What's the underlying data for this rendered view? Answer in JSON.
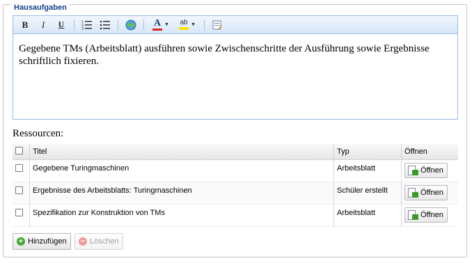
{
  "section": {
    "title": "Hausaufgaben"
  },
  "toolbar": {
    "bold": "B",
    "italic": "I",
    "underline": "U",
    "font_color": "A",
    "highlight": "ab"
  },
  "editor": {
    "content": "Gegebene TMs (Arbeitsblatt) ausführen sowie Zwischenschritte der Ausführung sowie Ergebnisse schriftlich fixieren."
  },
  "resources": {
    "label": "Ressourcen:",
    "columns": {
      "title": "Titel",
      "type": "Typ",
      "open": "Öffnen"
    },
    "rows": [
      {
        "title": "Gegebene Turingmaschinen",
        "type": "Arbeitsblatt",
        "open_label": "Öffnen"
      },
      {
        "title": "Ergebnisse des Arbeitsblatts: Turingmaschinen",
        "type": "Schüler erstellt",
        "open_label": "Öffnen"
      },
      {
        "title": "Spezifikation zur Konstruktion von TMs",
        "type": "Arbeitsblatt",
        "open_label": "Öffnen"
      }
    ]
  },
  "actions": {
    "add": "Hinzufügen",
    "delete": "Löschen"
  },
  "colors": {
    "accent": "#15428b",
    "border": "#99bbe8",
    "font_color_bar": "#e02020",
    "highlight_bar": "#f5e600"
  }
}
